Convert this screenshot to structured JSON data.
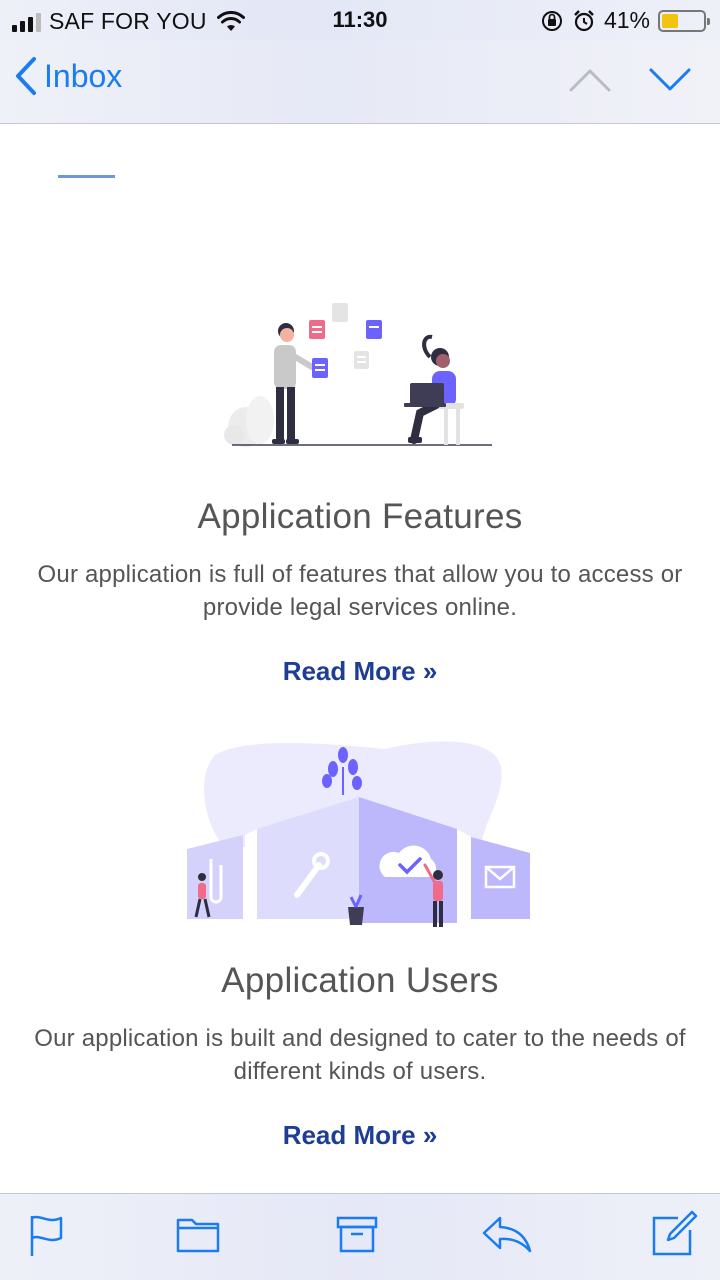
{
  "status_bar": {
    "carrier": "SAF FOR YOU",
    "time": "11:30",
    "battery_percent": "41%",
    "battery_level": 0.41,
    "battery_color": "#f2c40f"
  },
  "nav": {
    "back_label": "Inbox",
    "accent_color": "#1a7cf0"
  },
  "sections": [
    {
      "title": "Application Features",
      "description": "Our application is full of features that allow you to access or provide legal services online.",
      "read_more": "Read More »",
      "illustration": "people-sharing-documents-illustration"
    },
    {
      "title": "Application Users",
      "description": "Our application is built and designed to cater to the needs of different kinds of users.",
      "read_more": "Read More »",
      "illustration": "users-app-panels-illustration"
    }
  ],
  "colors": {
    "link": "#1e3e96",
    "illustration_purple": "#6c63ff",
    "illustration_pink": "#f06b8a"
  },
  "toolbar": {
    "icons": [
      "flag-icon",
      "folder-icon",
      "archive-icon",
      "reply-icon",
      "compose-icon"
    ]
  }
}
